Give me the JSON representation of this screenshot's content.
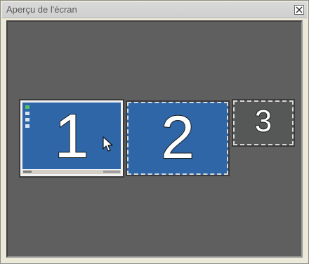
{
  "window": {
    "title": "Aperçu de l'écran"
  },
  "monitors": [
    {
      "number": "1",
      "active": true
    },
    {
      "number": "2",
      "active": false
    },
    {
      "number": "3",
      "active": false
    }
  ],
  "colors": {
    "desktop_blue": "#2e66a8",
    "inactive_gray": "#555856",
    "background": "#5f5f5f"
  },
  "icons": {
    "close": "close-icon",
    "cursor": "mouse-pointer-icon"
  }
}
